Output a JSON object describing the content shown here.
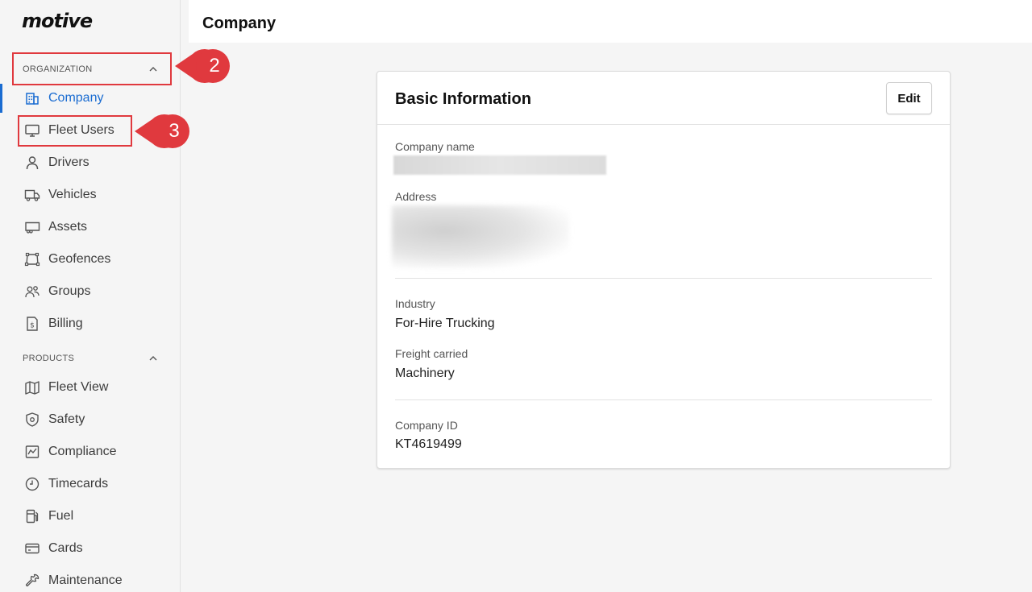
{
  "brand": {
    "logo_text": "motive"
  },
  "sidebar": {
    "organization_header": "ORGANIZATION",
    "organization_items": [
      {
        "label": "Company",
        "icon": "building-icon",
        "active": true
      },
      {
        "label": "Fleet Users",
        "icon": "monitor-icon"
      },
      {
        "label": "Drivers",
        "icon": "person-icon"
      },
      {
        "label": "Vehicles",
        "icon": "truck-icon"
      },
      {
        "label": "Assets",
        "icon": "trailer-icon"
      },
      {
        "label": "Geofences",
        "icon": "geofence-icon"
      },
      {
        "label": "Groups",
        "icon": "group-icon"
      },
      {
        "label": "Billing",
        "icon": "billing-icon"
      }
    ],
    "products_header": "PRODUCTS",
    "products_items": [
      {
        "label": "Fleet View",
        "icon": "map-icon"
      },
      {
        "label": "Safety",
        "icon": "shield-icon"
      },
      {
        "label": "Compliance",
        "icon": "compliance-icon"
      },
      {
        "label": "Timecards",
        "icon": "clock-icon"
      },
      {
        "label": "Fuel",
        "icon": "fuel-icon"
      },
      {
        "label": "Cards",
        "icon": "card-icon"
      },
      {
        "label": "Maintenance",
        "icon": "wrench-icon"
      }
    ]
  },
  "annotations": {
    "step_2": "2",
    "step_3": "3"
  },
  "header": {
    "title": "Company"
  },
  "card": {
    "title": "Basic Information",
    "edit_label": "Edit",
    "company_name_label": "Company name",
    "address_label": "Address",
    "industry_label": "Industry",
    "industry_value": "For-Hire Trucking",
    "freight_label": "Freight carried",
    "freight_value": "Machinery",
    "company_id_label": "Company ID",
    "company_id_value": "KT4619499"
  },
  "colors": {
    "accent": "#1a6cd1",
    "annotation": "#e0393e"
  }
}
